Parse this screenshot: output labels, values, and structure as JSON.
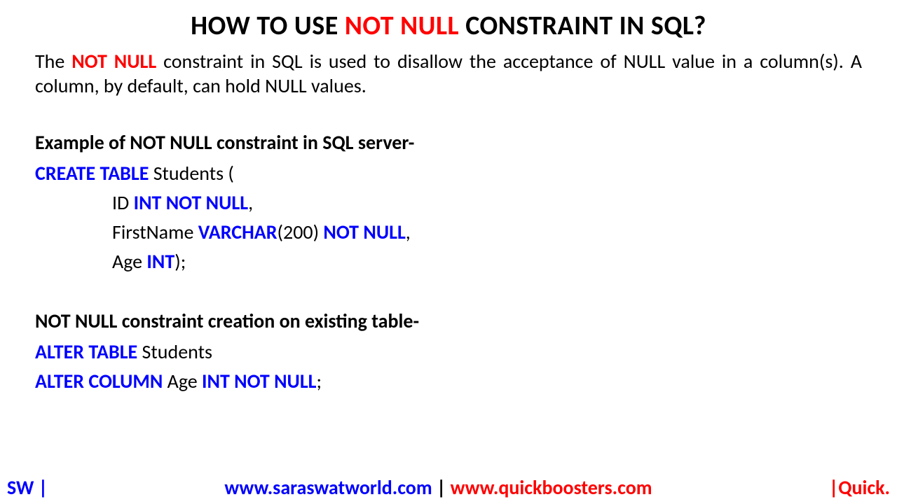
{
  "title": {
    "part1": "HOW TO USE ",
    "highlight": "NOT NULL",
    "part2": " CONSTRAINT IN SQL?"
  },
  "intro": {
    "part1": "The ",
    "highlight": "NOT NULL",
    "part2": " constraint in SQL is used to disallow the acceptance of NULL value in a column(s). A column, by default, can hold NULL values."
  },
  "example1": {
    "heading": "Example of NOT NULL constraint in SQL server-",
    "line1": {
      "kw": "CREATE TABLE",
      "rest": " Students ("
    },
    "line2": {
      "pre": "ID ",
      "kw": "INT NOT NULL",
      "post": ","
    },
    "line3": {
      "pre": "FirstName ",
      "kw1": "VARCHAR",
      "mid": "(200) ",
      "kw2": "NOT NULL",
      "post": ","
    },
    "line4": {
      "pre": "Age ",
      "kw": "INT",
      "post": ");"
    }
  },
  "example2": {
    "heading": "NOT NULL constraint creation on existing table-",
    "line1": {
      "kw": "ALTER TABLE",
      "rest": " Students"
    },
    "line2": {
      "kw1": "ALTER COLUMN",
      "mid": " Age ",
      "kw2": "INT NOT NULL",
      "post": ";"
    }
  },
  "footer": {
    "left": "SW |",
    "url1": "www.saraswatworld.com",
    "sep": " | ",
    "url2": "www.quickboosters.com",
    "right": "|Quick."
  }
}
